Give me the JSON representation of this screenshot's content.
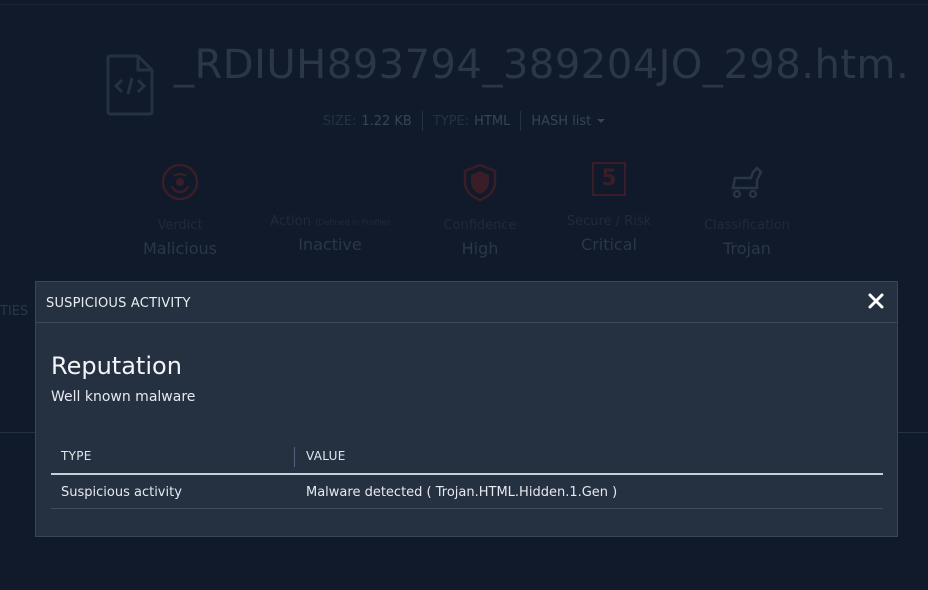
{
  "file": {
    "name": "_RDIUH893794_389204JO_298.htm.",
    "size_label": "SIZE:",
    "size_value": "1.22 KB",
    "type_label": "TYPE:",
    "type_value": "HTML",
    "hash_label": "HASH list"
  },
  "stats": [
    {
      "label": "Verdict",
      "value": "Malicious",
      "icon": "biohazard-icon"
    },
    {
      "label": "Action",
      "label_note": "(Defined in Profile)",
      "value": "Inactive",
      "icon": "none"
    },
    {
      "label": "Confidence",
      "value": "High",
      "icon": "shield-icon"
    },
    {
      "label": "Secure / Risk",
      "value": "Critical",
      "icon_text": "5"
    },
    {
      "label": "Classification",
      "value": "Trojan",
      "icon": "trojan-horse-icon"
    }
  ],
  "side_fragment": "TIES",
  "modal": {
    "title": "SUSPICIOUS ACTIVITY",
    "close_label": "✕",
    "heading": "Reputation",
    "subheading": "Well known malware",
    "table": {
      "columns": [
        "TYPE",
        "VALUE"
      ],
      "rows": [
        [
          "Suspicious activity",
          "Malware detected ( Trojan.HTML.Hidden.1.Gen )"
        ]
      ]
    }
  },
  "colors": {
    "background": "#101a2a",
    "modal_bg": "#253041",
    "text_primary": "#e9edf2"
  }
}
